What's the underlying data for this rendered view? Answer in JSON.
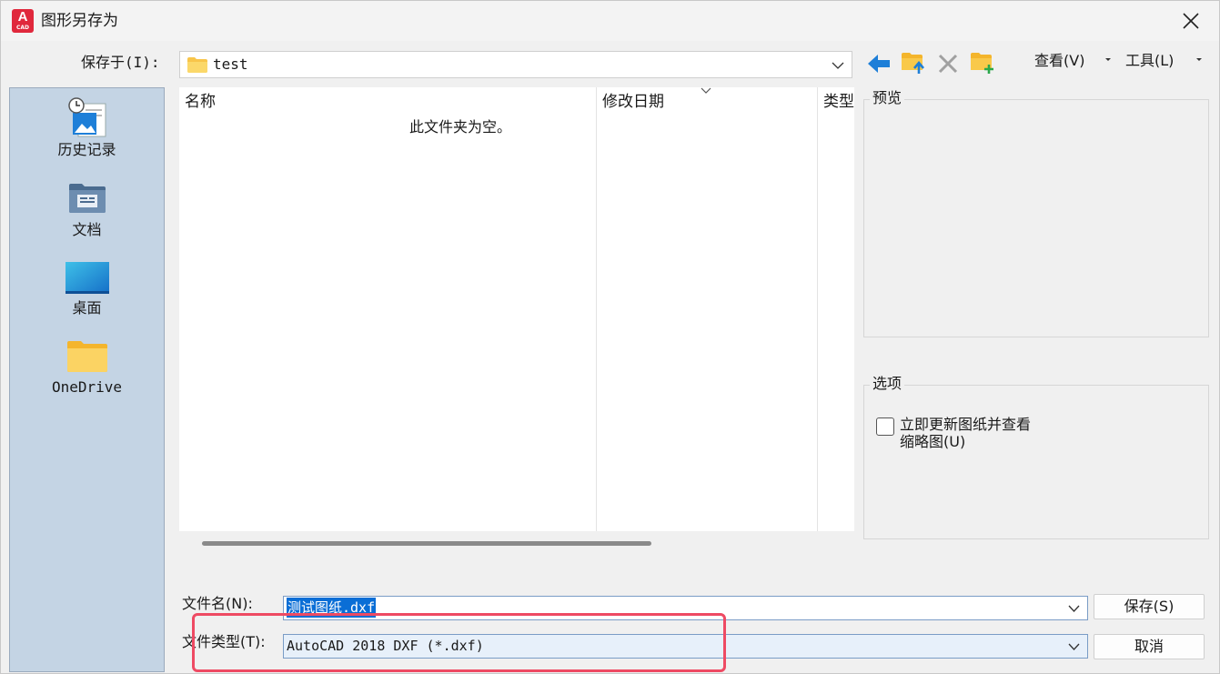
{
  "window": {
    "title": "图形另存为",
    "icon": "autocad-icon",
    "icon_text": "A",
    "icon_subtext": "CAD"
  },
  "save_in": {
    "label": "保存于(I):",
    "value": "test"
  },
  "toolbar": {
    "view_label": "查看(V)",
    "tools_label": "工具(L)",
    "icons": [
      "back-arrow-icon",
      "up-folder-icon",
      "delete-icon",
      "new-folder-icon"
    ]
  },
  "places": [
    {
      "label": "历史记录",
      "icon": "history-icon"
    },
    {
      "label": "文档",
      "icon": "documents-icon"
    },
    {
      "label": "桌面",
      "icon": "desktop-icon"
    },
    {
      "label": "OneDrive",
      "icon": "folder-icon"
    }
  ],
  "file_list": {
    "columns": [
      "名称",
      "修改日期",
      "类型"
    ],
    "empty_message": "此文件夹为空。"
  },
  "preview": {
    "title": "预览"
  },
  "options": {
    "title": "选项",
    "checkbox_label_line1": "立即更新图纸并查看",
    "checkbox_label_line2": "缩略图(U)",
    "checked": false
  },
  "file_name": {
    "label": "文件名(N):",
    "value": "测试图纸.dxf"
  },
  "file_type": {
    "label": "文件类型(T):",
    "value": "AutoCAD 2018 DXF (*.dxf)"
  },
  "buttons": {
    "save_label": "保存(S)",
    "cancel_label": "取消"
  },
  "colors": {
    "highlight_box": "#ee4a63",
    "places_bg": "#c4d4e4",
    "selection": "#0a6ed6",
    "accent_blue": "#1e7fd8"
  }
}
